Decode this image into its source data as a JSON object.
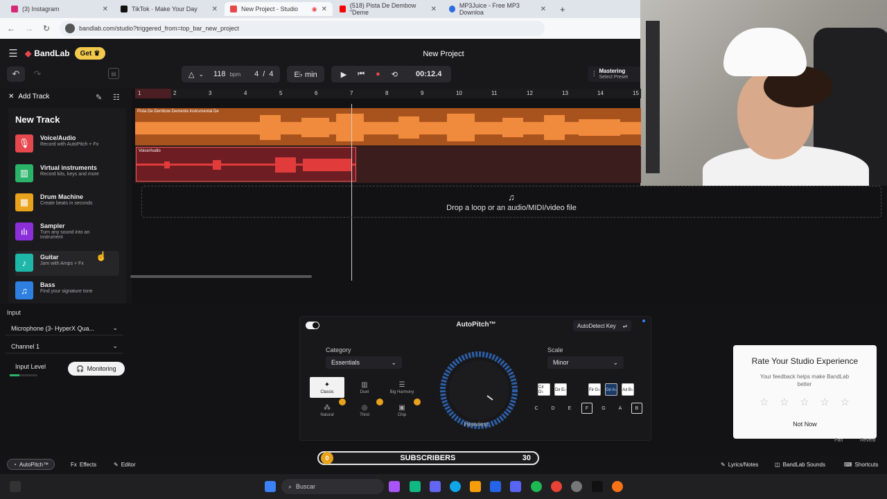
{
  "browser": {
    "tabs": [
      {
        "title": "(3) Instagram",
        "color": "#d62976"
      },
      {
        "title": "TikTok · Make Your Day",
        "color": "#111111"
      },
      {
        "title": "New Project - Studio",
        "color": "#e5484d"
      },
      {
        "title": "(518) Pista De Dembow \"Deme",
        "color": "#ff0000"
      },
      {
        "title": "MP3Juice - Free MP3 Downloa",
        "color": "#2d6cdf"
      }
    ],
    "url": "bandlab.com/studio?triggered_from=top_bar_new_project"
  },
  "header": {
    "brand": "BandLab",
    "get_label": "Get",
    "project_title": "New Project",
    "bpm": "118",
    "bpm_unit": "bpm",
    "time_sig_top": "4",
    "time_sig_slash": "/",
    "time_sig_bottom": "4",
    "key": "E♭ min",
    "time": "00:12.4",
    "mastering": "Mastering",
    "mastering_sub": "Select Preset"
  },
  "toolbar": {
    "add_track": "Add Track"
  },
  "ruler": [
    "1",
    "2",
    "3",
    "4",
    "5",
    "6",
    "7",
    "8",
    "9",
    "10",
    "11",
    "12",
    "13",
    "14",
    "15"
  ],
  "tracks": {
    "track1_label": "Pista De Dembow Demente instrumental De",
    "track2_label": "Voice/Audio"
  },
  "dropzone": "Drop a loop or an audio/MIDI/video file",
  "new_track": {
    "title": "New Track",
    "items": [
      {
        "name": "Voice/Audio",
        "desc": "Record with AutoPitch + Fx",
        "color": "#e5484d"
      },
      {
        "name": "Virtual instruments",
        "desc": "Record kits, keys and more",
        "color": "#2bb36a"
      },
      {
        "name": "Drum Machine",
        "desc": "Create beats in seconds",
        "color": "#e8a21c"
      },
      {
        "name": "Sampler",
        "desc": "Turn any sound into an instrument",
        "color": "#8b2fd9"
      },
      {
        "name": "Guitar",
        "desc": "Jam with Amps + Fx",
        "color": "#1fb8a8"
      },
      {
        "name": "Bass",
        "desc": "Find your signature tone",
        "color": "#2f7fe0"
      }
    ]
  },
  "input": {
    "label": "Input",
    "device": "Microphone (3- HyperX Qua...",
    "channel": "Channel 1",
    "input_level": "Input Level",
    "monitoring": "Monitoring"
  },
  "autopitch": {
    "title": "AutoPitch™",
    "autodetect": "AutoDetect Key",
    "category_label": "Category",
    "category_value": "Essentials",
    "scale_label": "Scale",
    "scale_value": "Minor",
    "dial_label": "Heaviest",
    "modes": [
      "Classic",
      "Duet",
      "Big Harmony",
      "Natural",
      "Third",
      "Chip"
    ],
    "chips": [
      "C♯ D♭",
      "D♯ E♭",
      "F♯ G♭",
      "G♯ A♭",
      "A♯ B♭"
    ],
    "keys": [
      "C",
      "D",
      "E",
      "F",
      "G",
      "A",
      "B"
    ]
  },
  "rate": {
    "title": "Rate Your Studio Experience",
    "subtitle": "Your feedback helps make BandLab better",
    "not_now": "Not Now",
    "pan": "Pan",
    "reverb": "Reverb"
  },
  "bottom": {
    "autopitch": "AutoPitch™",
    "effects": "Effects",
    "editor": "Editor",
    "lyrics": "Lyrics/Notes",
    "sounds": "BandLab Sounds",
    "shortcuts": "Shortcuts"
  },
  "subscribers": {
    "current": "0",
    "label": "SUBSCRIBERS",
    "goal": "30"
  },
  "taskbar": {
    "search": "Buscar"
  },
  "colors": {
    "accent": "#e5484d",
    "track1": "#a8531e",
    "track2": "#6e1e22",
    "get_badge": "#f2c94c"
  }
}
